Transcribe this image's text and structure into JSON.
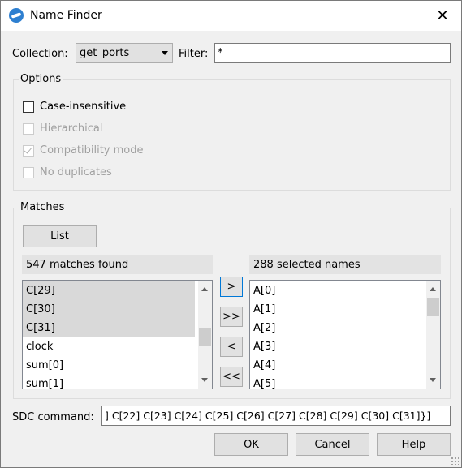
{
  "window": {
    "title": "Name Finder",
    "close": "✕"
  },
  "collection": {
    "label": "Collection:",
    "value": "get_ports"
  },
  "filter": {
    "label": "Filter:",
    "value": "*"
  },
  "options": {
    "title": "Options",
    "items": [
      {
        "label": "Case-insensitive",
        "checked": false,
        "enabled": true
      },
      {
        "label": "Hierarchical",
        "checked": false,
        "enabled": false
      },
      {
        "label": "Compatibility mode",
        "checked": true,
        "enabled": false
      },
      {
        "label": "No duplicates",
        "checked": false,
        "enabled": false
      }
    ]
  },
  "matches": {
    "title": "Matches",
    "list_button": "List",
    "found_header": "547 matches found",
    "found_items": [
      "C[29]",
      "C[30]",
      "C[31]",
      "clock",
      "sum[0]",
      "sum[1]"
    ],
    "selected_header": "288 selected names",
    "selected_items": [
      "A[0]",
      "A[1]",
      "A[2]",
      "A[3]",
      "A[4]",
      "A[5]"
    ],
    "move_buttons": [
      ">",
      ">>",
      "<",
      "<<"
    ]
  },
  "sdc": {
    "label": "SDC command:",
    "value": "] C[22] C[23] C[24] C[25] C[26] C[27] C[28] C[29] C[30] C[31]}]"
  },
  "footer": {
    "ok": "OK",
    "cancel": "Cancel",
    "help": "Help"
  }
}
